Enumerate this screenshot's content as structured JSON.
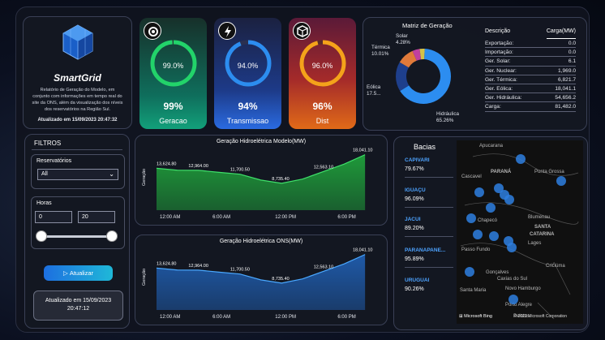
{
  "brand": {
    "title": "SmartGrid",
    "description": "Relatório de Geração do Modelo, em conjunto com informações em tempo real do site da ONS, além da visualização dos níveis dos reservatórios na Região Sul.",
    "updated": "Atualizado em 15/09/2023 20:47:32"
  },
  "kpis": [
    {
      "ring": "99.0%",
      "value": "99%",
      "label": "Geracao",
      "fraction": 0.99,
      "ring_color": "#22d36a"
    },
    {
      "ring": "94.0%",
      "value": "94%",
      "label": "Transmissao",
      "fraction": 0.94,
      "ring_color": "#2c8df0"
    },
    {
      "ring": "96.0%",
      "value": "96%",
      "label": "Dist",
      "fraction": 0.96,
      "ring_color": "#f5a21a"
    }
  ],
  "matriz": {
    "title": "Matriz de Geração",
    "pie_labels": {
      "solar": "Solar\n4.28%",
      "termica": "Térmica\n10.01%",
      "eolica": "Eólica\n17.5...",
      "hidraulica": "Hidráulica\n65.26%"
    },
    "table_headers": [
      "Descrição",
      "Carga(MW)"
    ],
    "table_rows": [
      [
        "Exportação:",
        "0.0"
      ],
      [
        "Importação:",
        "0.0"
      ],
      [
        "Ger. Solar:",
        "6.1"
      ],
      [
        "Ger. Nuclear:",
        "1,969.0"
      ],
      [
        "Ger. Térmica:",
        "6,821.7"
      ],
      [
        "Ger. Eólica:",
        "18,041.1"
      ],
      [
        "Ger. Hidráulica:",
        "54,656.2"
      ],
      [
        "Carga:",
        "81,482.0"
      ]
    ],
    "colors": {
      "hidraulica": "#2c8df0",
      "eolica": "#1e3f8c",
      "termica": "#e07a3a",
      "solar": "#c040a0",
      "nuclear": "#d4c24a"
    }
  },
  "filtros": {
    "title": "FILTROS",
    "reservatorios_label": "Reservatórios",
    "reservatorios_value": "All",
    "horas_label": "Horas",
    "hora_min": "0",
    "hora_max": "20",
    "button": "Atualizar",
    "updated_line1": "Atualizado em 15/09/2023",
    "updated_line2": "20:47:12"
  },
  "chart_data": [
    {
      "type": "area",
      "title": "Geração Hidroelétrica Modelo(MW)",
      "ylabel": "Geração",
      "xlabel": "",
      "x_ticks": [
        "12:00 AM",
        "6:00 AM",
        "12:00 PM",
        "6:00 PM"
      ],
      "x": [
        0,
        2,
        4,
        6,
        8,
        10,
        12,
        14,
        16,
        18,
        20
      ],
      "values": [
        13624.8,
        13000,
        12964,
        12300,
        11700.5,
        9800,
        8735.4,
        10100,
        12563.1,
        15000,
        18041.1
      ],
      "data_labels": [
        {
          "x": 0,
          "text": "13,624.80"
        },
        {
          "x": 4,
          "text": "12,964.00"
        },
        {
          "x": 8,
          "text": "11,700.50"
        },
        {
          "x": 12,
          "text": "8,735.40"
        },
        {
          "x": 16,
          "text": "12,563.10"
        },
        {
          "x": 20,
          "text": "18,041.10"
        }
      ],
      "ylim": [
        0,
        19000
      ],
      "color": "#1f9a3a"
    },
    {
      "type": "area",
      "title": "Geração Hidroelétrica ONS(MW)",
      "ylabel": "Geração",
      "xlabel": "",
      "x_ticks": [
        "12:00 AM",
        "6:00 AM",
        "12:00 PM",
        "6:00 PM"
      ],
      "x": [
        0,
        2,
        4,
        6,
        8,
        10,
        12,
        14,
        16,
        18,
        20
      ],
      "values": [
        13624.8,
        13000,
        12964,
        12300,
        11700.5,
        9800,
        8735.4,
        10100,
        12563.1,
        15000,
        18041.1
      ],
      "data_labels": [
        {
          "x": 0,
          "text": "13,624.80"
        },
        {
          "x": 4,
          "text": "12,964.00"
        },
        {
          "x": 8,
          "text": "11,700.50"
        },
        {
          "x": 12,
          "text": "8,735.40"
        },
        {
          "x": 16,
          "text": "12,563.10"
        },
        {
          "x": 20,
          "text": "18,041.10"
        }
      ],
      "ylim": [
        0,
        19000
      ],
      "color": "#1f5aa8"
    }
  ],
  "bacias": {
    "title": "Bacias",
    "items": [
      {
        "name": "CAPIVARI",
        "value": "79.67%"
      },
      {
        "name": "IGUAÇU",
        "value": "96.09%"
      },
      {
        "name": "JACUI",
        "value": "89.20%"
      },
      {
        "name": "PARANAPANE...",
        "value": "95.89%"
      },
      {
        "name": "URUGUAI",
        "value": "90.26%"
      }
    ]
  },
  "map": {
    "labels": [
      "Apucarana",
      "Cascavel",
      "PARANÁ",
      "Ponta Grossa",
      "Chapecó",
      "Blumenau",
      "SANTA",
      "CATARINA",
      "Lages",
      "Passo Fundo",
      "Criciúma",
      "Santa Maria",
      "Caxias do Sul",
      "Novo Hamburgo",
      "Porto Alegre",
      "Pelotas",
      "Gonçalves"
    ],
    "attribution": "Microsoft Bing",
    "copyright": "© 2023 Microsoft Corporation"
  }
}
